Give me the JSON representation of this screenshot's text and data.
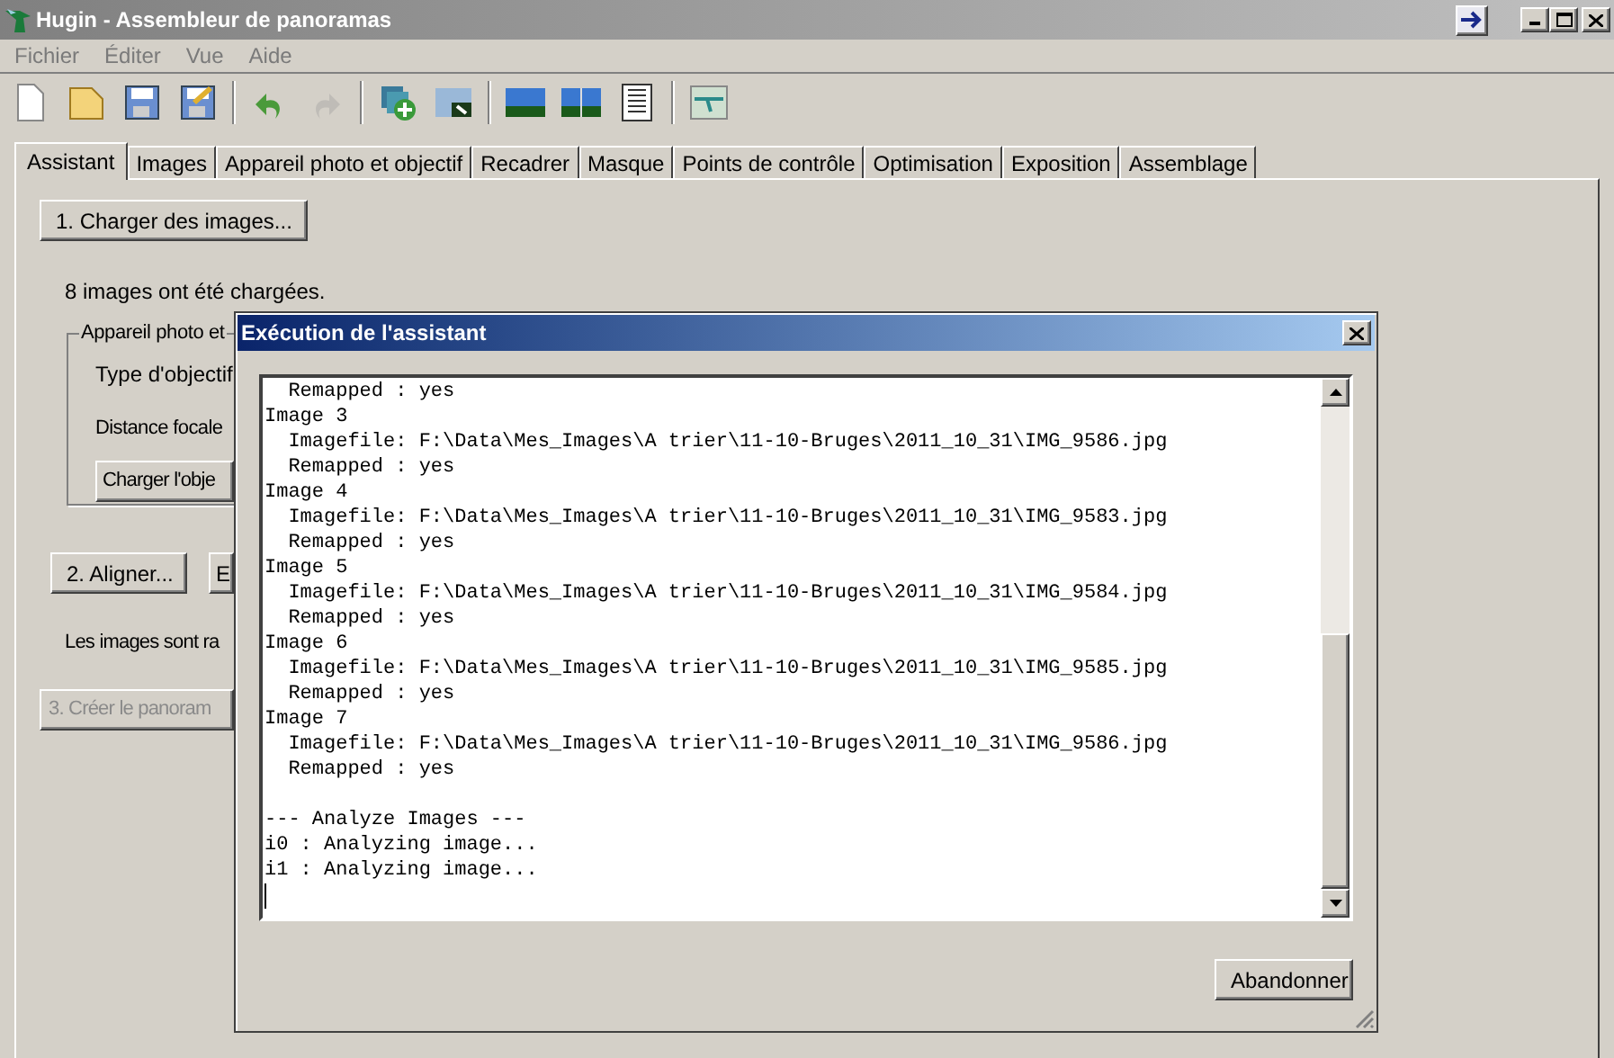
{
  "window": {
    "title": "Hugin - Assembleur de panoramas"
  },
  "menu": [
    "Fichier",
    "Éditer",
    "Vue",
    "Aide"
  ],
  "toolbar": [
    {
      "kind": "new",
      "disabled": false
    },
    {
      "kind": "open",
      "disabled": false
    },
    {
      "kind": "save",
      "disabled": false
    },
    {
      "kind": "saveas",
      "disabled": false
    },
    {
      "kind": "separator"
    },
    {
      "kind": "undo",
      "disabled": false
    },
    {
      "kind": "redo",
      "disabled": true
    },
    {
      "kind": "separator"
    },
    {
      "kind": "add",
      "disabled": false
    },
    {
      "kind": "photo",
      "disabled": false
    },
    {
      "kind": "separator"
    },
    {
      "kind": "gl",
      "disabled": false
    },
    {
      "kind": "preview",
      "disabled": false
    },
    {
      "kind": "list",
      "disabled": false
    },
    {
      "kind": "separator"
    },
    {
      "kind": "tool",
      "disabled": false
    }
  ],
  "tabs": [
    {
      "label": "Assistant",
      "selected": true
    },
    {
      "label": "Images",
      "selected": false
    },
    {
      "label": "Appareil photo et objectif",
      "selected": false
    },
    {
      "label": "Recadrer",
      "selected": false
    },
    {
      "label": "Masque",
      "selected": false
    },
    {
      "label": "Points de contrôle",
      "selected": false
    },
    {
      "label": "Optimisation",
      "selected": false
    },
    {
      "label": "Exposition",
      "selected": false
    },
    {
      "label": "Assemblage",
      "selected": false
    }
  ],
  "assistant": {
    "load_button": {
      "label": "1. Charger des images...",
      "disabled": false
    },
    "status": "8 images ont été chargées.",
    "group": {
      "title": "Appareil photo et",
      "lens_label": "Type d'objectif",
      "focal_label": "Distance focale",
      "load_lens_button": "Charger l'obje"
    },
    "align_button": {
      "label": "2. Aligner...",
      "disabled": false
    },
    "button_2": {
      "label": "E",
      "disabled": false
    },
    "align_status": "Les images sont ra",
    "create_button": {
      "label": "3. Créer le panoram",
      "disabled": true
    }
  },
  "dialog": {
    "title": "Exécution de l'assistant",
    "log": [
      "  Remapped : yes",
      "Image 3",
      "  Imagefile: F:\\Data\\Mes_Images\\A trier\\11-10-Bruges\\2011_10_31\\IMG_9586.jpg",
      "  Remapped : yes",
      "Image 4",
      "  Imagefile: F:\\Data\\Mes_Images\\A trier\\11-10-Bruges\\2011_10_31\\IMG_9583.jpg",
      "  Remapped : yes",
      "Image 5",
      "  Imagefile: F:\\Data\\Mes_Images\\A trier\\11-10-Bruges\\2011_10_31\\IMG_9584.jpg",
      "  Remapped : yes",
      "Image 6",
      "  Imagefile: F:\\Data\\Mes_Images\\A trier\\11-10-Bruges\\2011_10_31\\IMG_9585.jpg",
      "  Remapped : yes",
      "Image 7",
      "  Imagefile: F:\\Data\\Mes_Images\\A trier\\11-10-Bruges\\2011_10_31\\IMG_9586.jpg",
      "  Remapped : yes"
    ],
    "log_tail": [
      "--- Analyze Images ---",
      "i0 : Analyzing image...",
      "i1 : Analyzing image..."
    ],
    "cancel_button": "Abandonner"
  }
}
